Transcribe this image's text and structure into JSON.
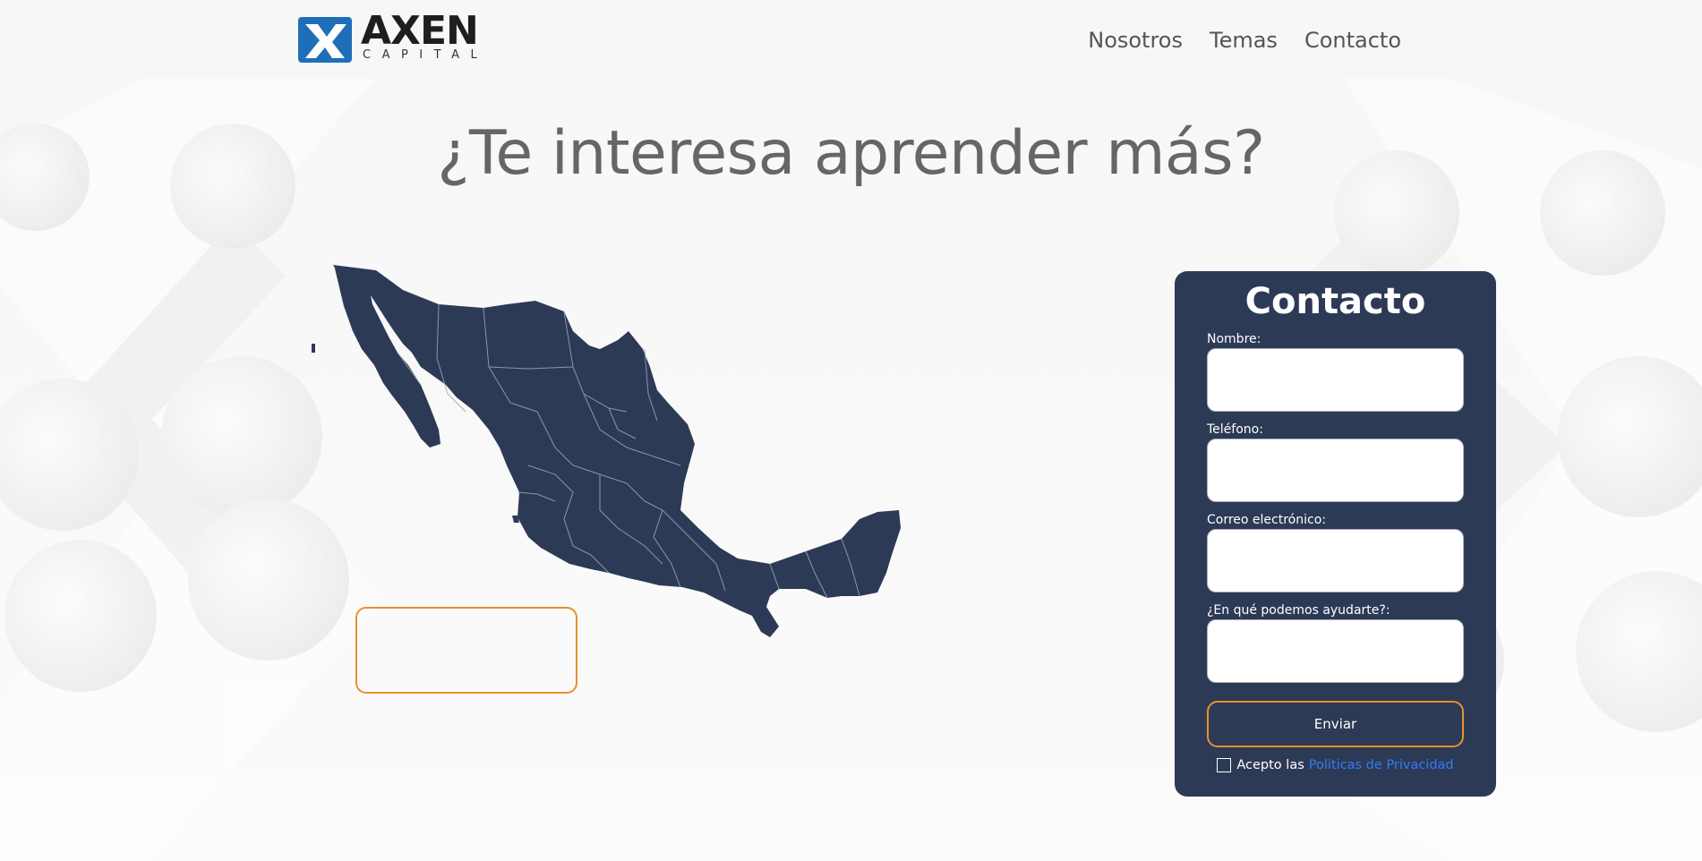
{
  "brand": {
    "name": "AXEN",
    "subtitle": "CAPITAL",
    "logo_color": "#1e6fb8"
  },
  "nav": {
    "items": [
      "Nosotros",
      "Temas",
      "Contacto"
    ]
  },
  "hero": {
    "title": "¿Te interesa aprender más?"
  },
  "map": {
    "icon": "mexico-map",
    "fill": "#2d3a56"
  },
  "form": {
    "title": "Contacto",
    "fields": [
      {
        "label": "Nombre:",
        "value": ""
      },
      {
        "label": "Teléfono:",
        "value": ""
      },
      {
        "label": "Correo electrónico:",
        "value": ""
      },
      {
        "label": "¿En qué podemos ayudarte?:",
        "value": ""
      }
    ],
    "submit_label": "Enviar",
    "consent_text": "Acepto las",
    "consent_link": "Politicas de Privacidad",
    "accent": "#e8912c",
    "card_color": "#2d3a56",
    "link_color": "#2f7df6"
  }
}
